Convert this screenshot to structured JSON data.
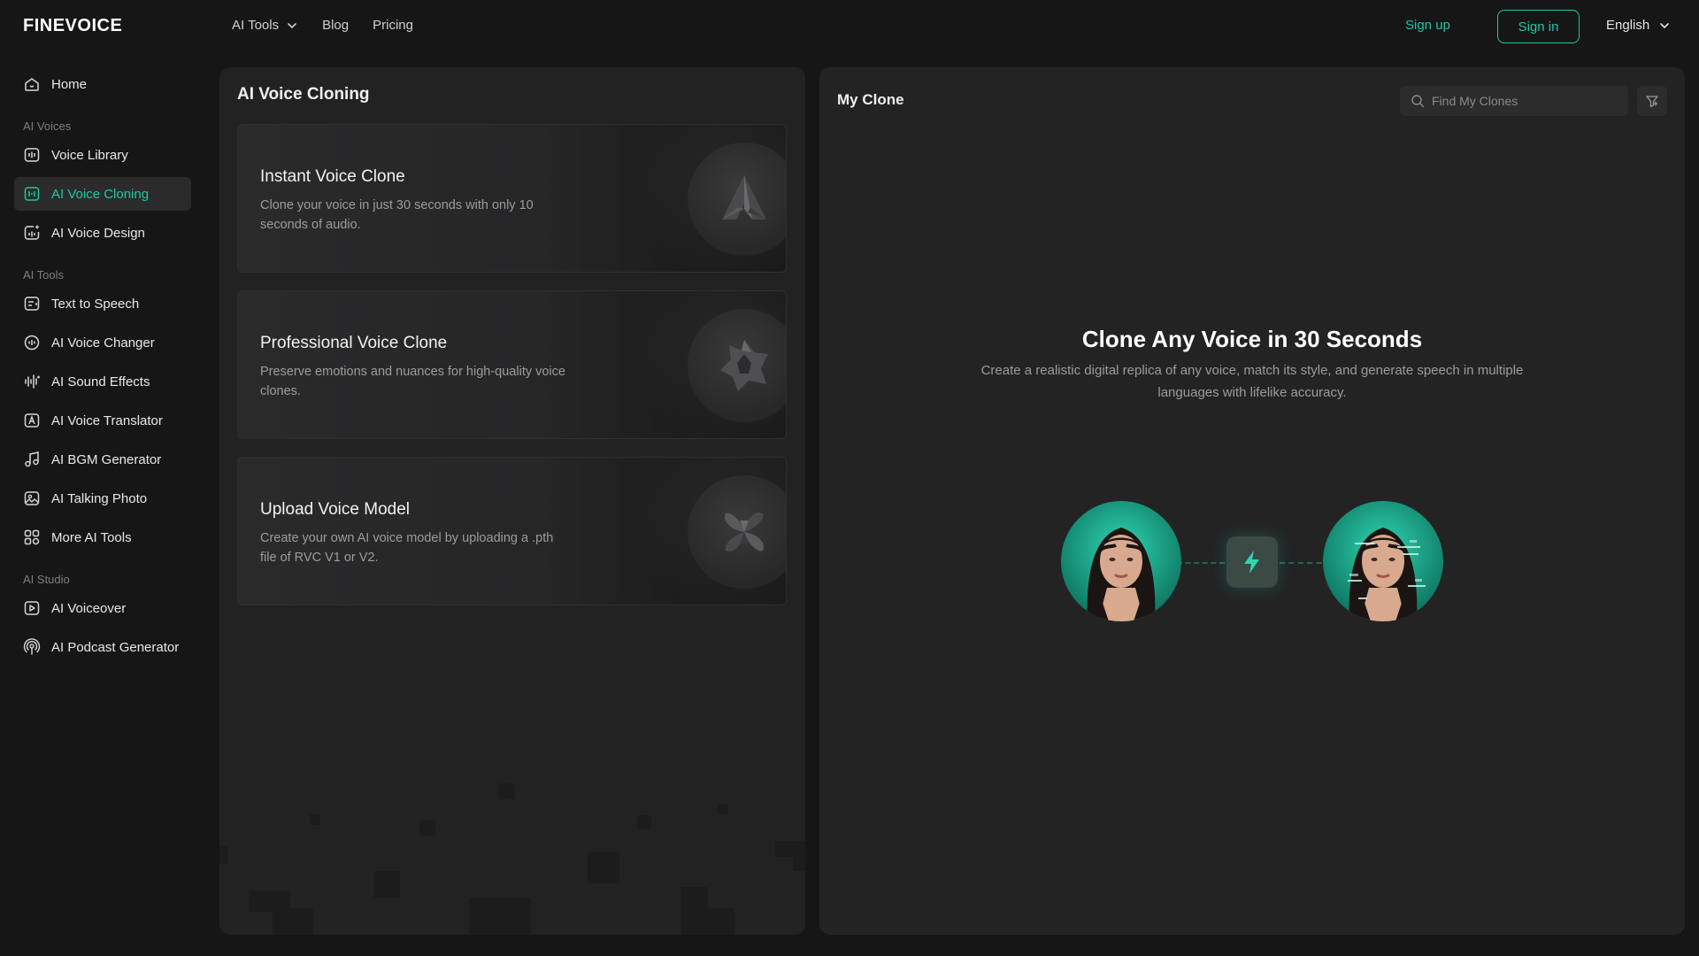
{
  "brand": {
    "logo": "FINEVOICE",
    "accent": "#1fc6a6"
  },
  "topnav": {
    "links": [
      {
        "label": "AI Tools",
        "has_dropdown": true
      },
      {
        "label": "Blog"
      },
      {
        "label": "Pricing"
      }
    ],
    "sign_up": "Sign up",
    "sign_in": "Sign in",
    "language": "English"
  },
  "sidebar": {
    "home": "Home",
    "groups": [
      {
        "title": "AI Voices",
        "items": [
          {
            "label": "Voice Library",
            "icon": "voice-library-icon"
          },
          {
            "label": "AI Voice Cloning",
            "icon": "voice-cloning-icon",
            "active": true
          },
          {
            "label": "AI Voice Design",
            "icon": "voice-design-icon"
          }
        ]
      },
      {
        "title": "AI Tools",
        "items": [
          {
            "label": "Text to Speech",
            "icon": "text-to-speech-icon"
          },
          {
            "label": "AI Voice Changer",
            "icon": "voice-changer-icon"
          },
          {
            "label": "AI Sound Effects",
            "icon": "sound-effects-icon"
          },
          {
            "label": "AI Voice Translator",
            "icon": "voice-translator-icon"
          },
          {
            "label": "AI BGM Generator",
            "icon": "music-note-icon"
          },
          {
            "label": "AI Talking Photo",
            "icon": "talking-photo-icon"
          },
          {
            "label": "More AI Tools",
            "icon": "grid-icon"
          }
        ]
      },
      {
        "title": "AI Studio",
        "items": [
          {
            "label": "AI Voiceover",
            "icon": "voiceover-icon"
          },
          {
            "label": "AI Podcast Generator",
            "icon": "podcast-icon"
          }
        ]
      }
    ]
  },
  "cloning_panel": {
    "title": "AI Voice Cloning",
    "cards": [
      {
        "title": "Instant Voice Clone",
        "description": "Clone your voice in just 30 seconds with only 10 seconds of audio.",
        "emblem": "triangle-emblem-icon"
      },
      {
        "title": "Professional Voice Clone",
        "description": "Preserve emotions and nuances for high-quality voice clones.",
        "emblem": "star-emblem-icon"
      },
      {
        "title": "Upload Voice Model",
        "description": "Create your own AI voice model by uploading a .pth file of RVC V1 or V2.",
        "emblem": "petals-emblem-icon"
      }
    ]
  },
  "my_clone": {
    "title": "My Clone",
    "search_placeholder": "Find My Clones",
    "hero_title": "Clone Any Voice in 30 Seconds",
    "hero_description": "Create a realistic digital replica of any voice, match its style, and generate speech in multiple languages with lifelike accuracy."
  }
}
